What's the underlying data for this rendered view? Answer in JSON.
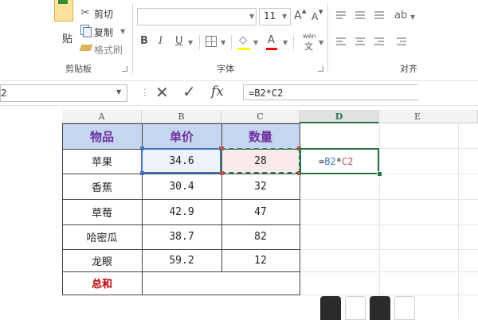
{
  "ribbon": {
    "clipboard": {
      "paste_label": "贴",
      "cut_label": "剪切",
      "copy_label": "复制",
      "format_painter_label": "格式刷",
      "group_label": "剪贴板"
    },
    "font": {
      "size_value": "11",
      "grow_label": "A",
      "shrink_label": "A",
      "bold_label": "B",
      "italic_label": "I",
      "underline_label": "U",
      "font_color_label": "A",
      "phonetic_label": "wén",
      "phonetic_char": "文",
      "group_label": "字体"
    },
    "alignment": {
      "group_label": "对齐"
    }
  },
  "formula_bar": {
    "name_box_value": "2",
    "cancel_symbol": "✕",
    "enter_symbol": "✓",
    "fx_label": "fx",
    "formula": "=B2*C2"
  },
  "sheet": {
    "columns": [
      "A",
      "B",
      "C",
      "D",
      "E"
    ],
    "active_column": "D",
    "headers": [
      "物品",
      "单价",
      "数量"
    ],
    "rows": [
      {
        "item": "苹果",
        "price": "34.6",
        "qty": "28"
      },
      {
        "item": "香蕉",
        "price": "30.4",
        "qty": "32"
      },
      {
        "item": "草莓",
        "price": "42.9",
        "qty": "47"
      },
      {
        "item": "哈密瓜",
        "price": "38.7",
        "qty": "82"
      },
      {
        "item": "龙眼",
        "price": "59.2",
        "qty": "12"
      }
    ],
    "total_label": "总和",
    "edit_cell": {
      "eq": "=",
      "ref1": "B2",
      "op": "*",
      "ref2": "C2"
    }
  },
  "colors": {
    "header_fill": "#c5d7f0",
    "header_text": "#7030a0",
    "total_text": "#c00000",
    "ref_blue": "#4472c4",
    "ref_red": "#c0504d",
    "excel_green": "#217346"
  }
}
